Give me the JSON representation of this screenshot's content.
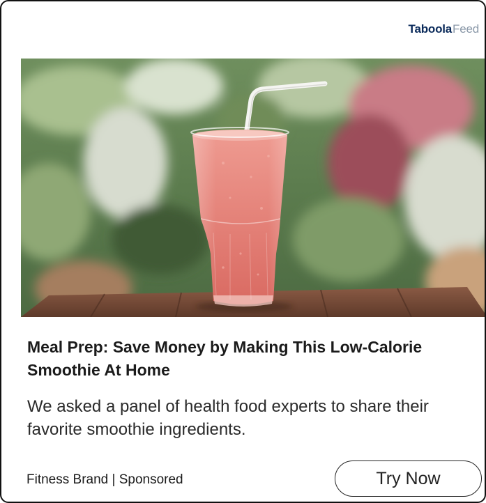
{
  "brand": {
    "main": "Taboola",
    "sub": "Feed"
  },
  "ad": {
    "image_alt_subject": "pink smoothie glass with white straw",
    "headline": "Meal Prep: Save Money by Making This Low-Calorie Smoothie At Home",
    "description": "We asked a panel of health food experts to share their favorite smoothie ingredients.",
    "sponsor": "Fitness Brand | Sponsored",
    "cta_label": "Try Now"
  },
  "colors": {
    "brand_main": "#0a2a5a",
    "brand_sub": "#8a98a8",
    "text": "#1b1b1b",
    "border": "#111111",
    "smoothie": "#e8857d"
  }
}
